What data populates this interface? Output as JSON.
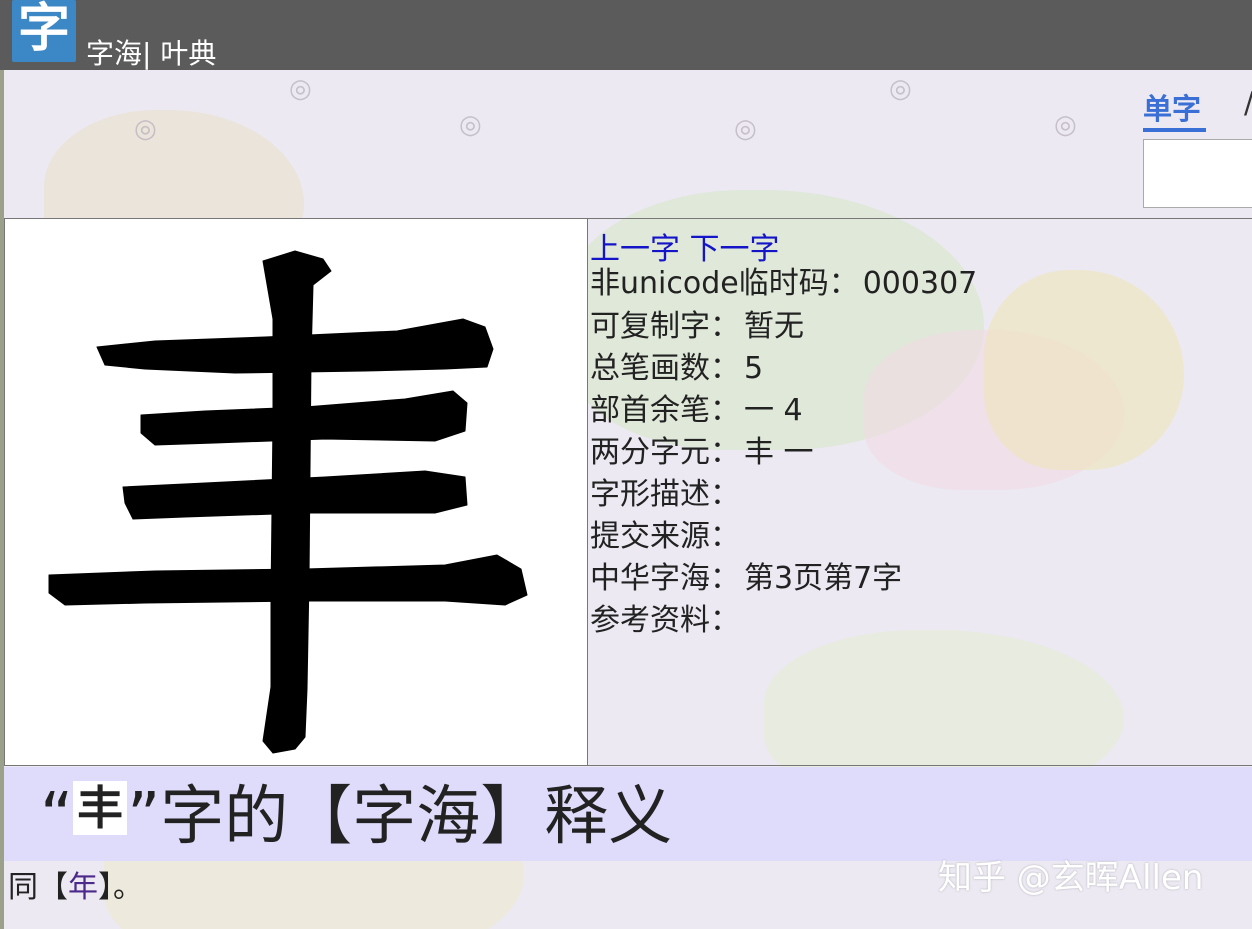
{
  "header": {
    "logo_char": "字",
    "title": "字海| 叶典"
  },
  "search_tabs": {
    "active": "单字",
    "partial_next": "/"
  },
  "glyph": {
    "name": "丰"
  },
  "nav": {
    "prev": "上一字",
    "next": "下一字"
  },
  "info": [
    {
      "label": "非unicode临时码：",
      "value": "000307"
    },
    {
      "label": "可复制字：",
      "value": "暂无"
    },
    {
      "label": "总笔画数：",
      "value": "5"
    },
    {
      "label": "部首余笔：",
      "value": "一 4"
    },
    {
      "label": "两分字元：",
      "value": "丰 一"
    },
    {
      "label": "字形描述：",
      "value": ""
    },
    {
      "label": "提交来源：",
      "value": ""
    },
    {
      "label": "中华字海：",
      "value": "第3页第7字"
    },
    {
      "label": "参考资料：",
      "value": ""
    }
  ],
  "definition": {
    "open_quote": "“",
    "char": "丰",
    "heading_rest": "”字的【字海】释义",
    "text_before": "同【",
    "link": "年",
    "text_after": "】。"
  },
  "watermark": "知乎 @玄晖Allen",
  "colors": {
    "header": "#5b5b5b",
    "accent_blue": "#3a6fd6",
    "link": "#1414c8",
    "band": "#dedbfb"
  }
}
